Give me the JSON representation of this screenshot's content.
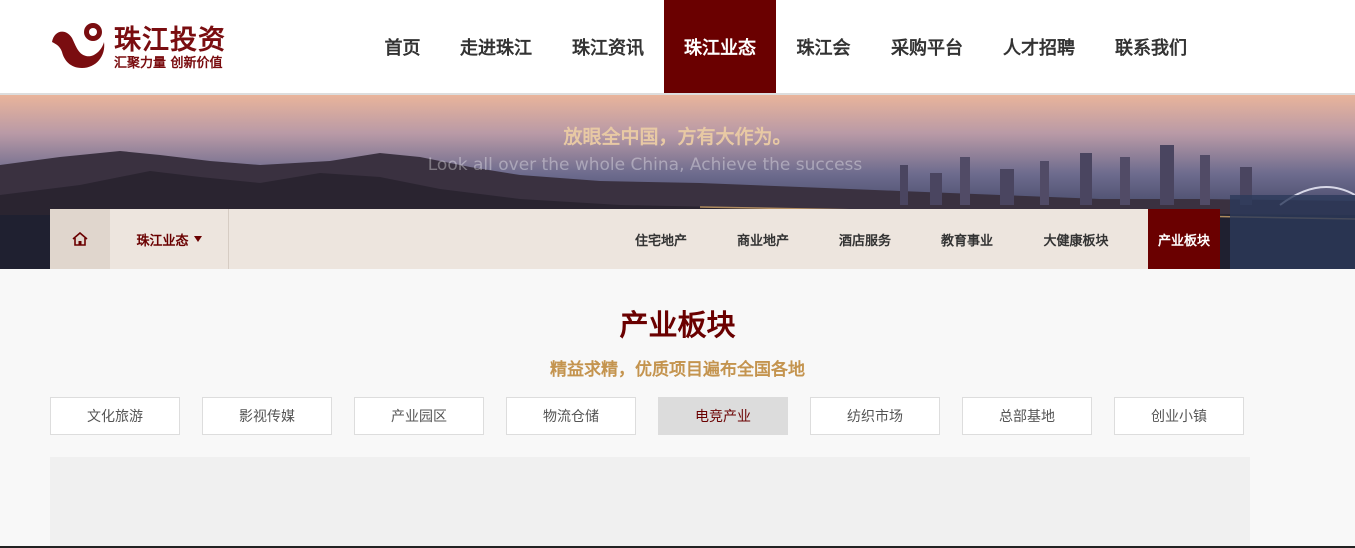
{
  "logo": {
    "title": "珠江投资",
    "slogan": "汇聚力量 创新价值",
    "color": "#7a0d10"
  },
  "nav": {
    "items": [
      {
        "label": "首页",
        "active": false
      },
      {
        "label": "走进珠江",
        "active": false
      },
      {
        "label": "珠江资讯",
        "active": false
      },
      {
        "label": "珠江业态",
        "active": true
      },
      {
        "label": "珠江会",
        "active": false
      },
      {
        "label": "采购平台",
        "active": false
      },
      {
        "label": "人才招聘",
        "active": false
      },
      {
        "label": "联系我们",
        "active": false
      }
    ]
  },
  "banner": {
    "title": "放眼全中国，方有大作为。",
    "subtitle": "Look all over the whole China, Achieve the success"
  },
  "subnav": {
    "home_icon": "home-icon",
    "section": "珠江业态",
    "items": [
      {
        "label": "住宅地产",
        "active": false
      },
      {
        "label": "商业地产",
        "active": false
      },
      {
        "label": "酒店服务",
        "active": false
      },
      {
        "label": "教育事业",
        "active": false
      },
      {
        "label": "大健康板块",
        "active": false
      },
      {
        "label": "产业板块",
        "active": true
      }
    ]
  },
  "main": {
    "title": "产业板块",
    "subtitle": "精益求精，优质项目遍布全国各地",
    "tabs": [
      {
        "label": "文化旅游",
        "active": false
      },
      {
        "label": "影视传媒",
        "active": false
      },
      {
        "label": "产业园区",
        "active": false
      },
      {
        "label": "物流仓储",
        "active": false
      },
      {
        "label": "电竞产业",
        "active": true
      },
      {
        "label": "纺织市场",
        "active": false
      },
      {
        "label": "总部基地",
        "active": false
      },
      {
        "label": "创业小镇",
        "active": false
      }
    ]
  },
  "colors": {
    "brand": "#6a0000",
    "accent_gold": "#c4944f",
    "subnav_bg": "#ede5de"
  }
}
